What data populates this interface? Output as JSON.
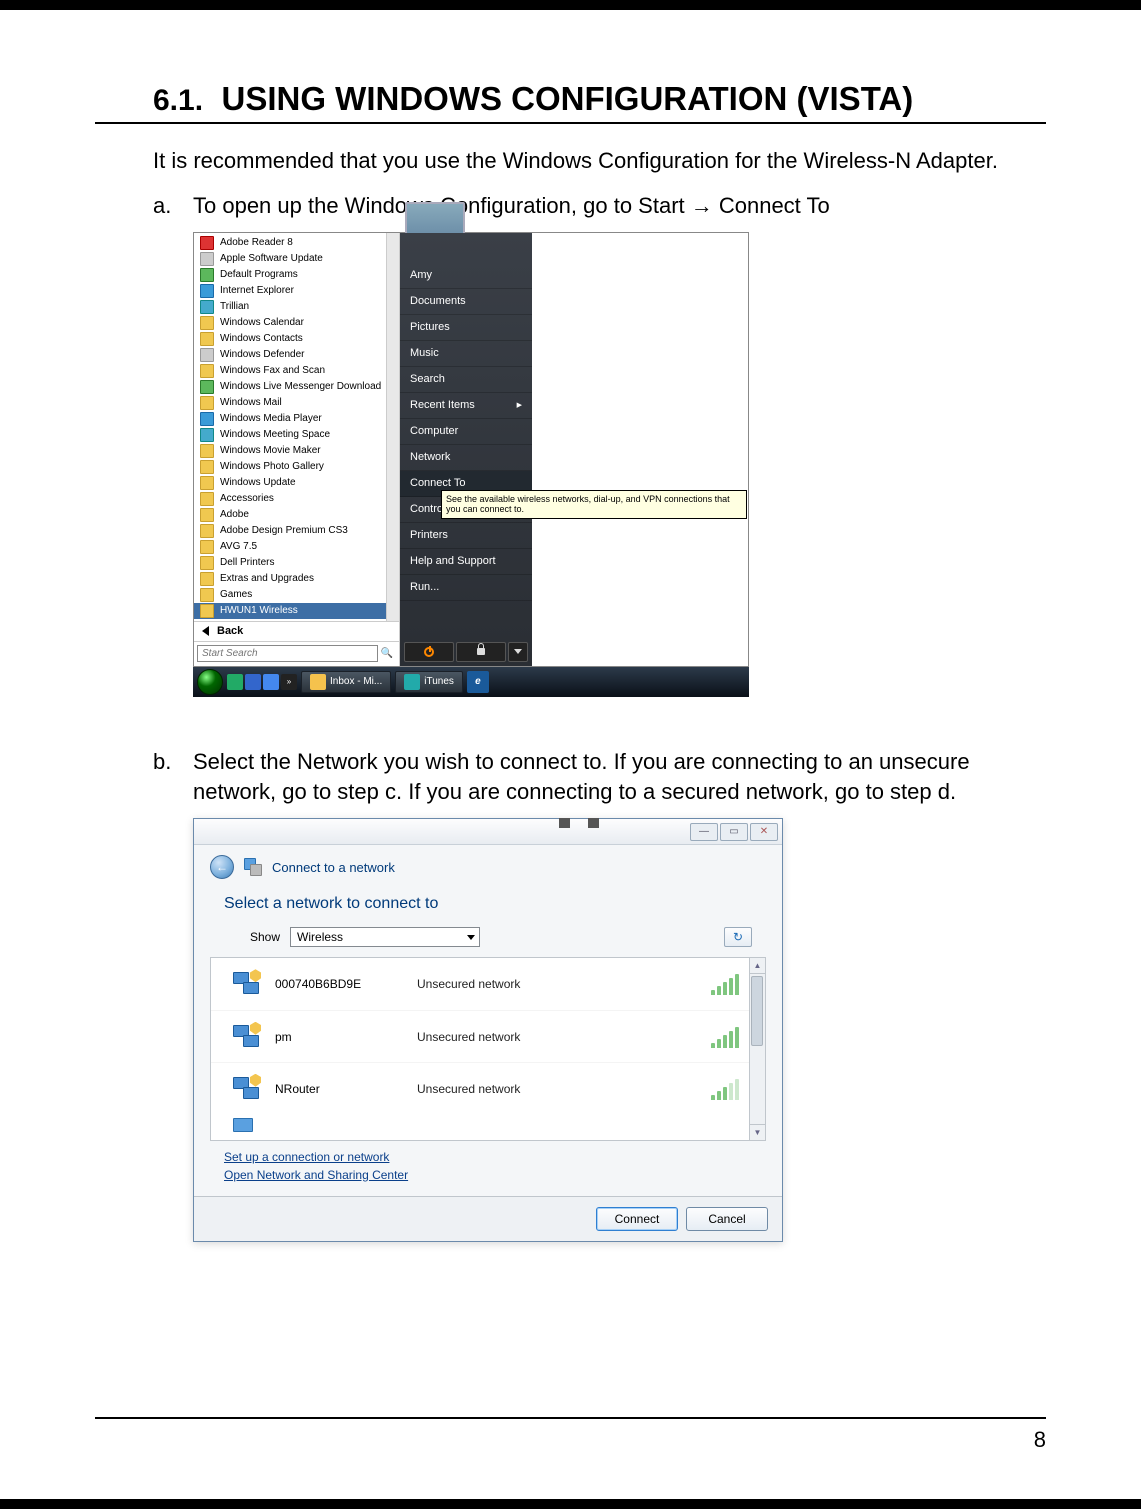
{
  "page_number": "8",
  "heading": {
    "num": "6.1.",
    "title": "USING WINDOWS CONFIGURATION (VISTA)"
  },
  "intro": "It is recommended that you use the Windows Configuration for the Wireless-N Adapter.",
  "step_a": {
    "marker": "a.",
    "text": "To open up the Windows Configuration, go to Start → Connect To"
  },
  "step_b": {
    "marker": "b.",
    "text": "Select the Network you wish to connect to. If you are connecting to an unsecure network, go to step c.  If you are connecting to a secured network, go to step d."
  },
  "start_menu": {
    "programs": [
      "Adobe Reader 8",
      "Apple Software Update",
      "Default Programs",
      "Internet Explorer",
      "Trillian",
      "Windows Calendar",
      "Windows Contacts",
      "Windows Defender",
      "Windows Fax and Scan",
      "Windows Live Messenger Download",
      "Windows Mail",
      "Windows Media Player",
      "Windows Meeting Space",
      "Windows Movie Maker",
      "Windows Photo Gallery",
      "Windows Update",
      "Accessories",
      "Adobe",
      "Adobe Design Premium CS3",
      "AVG 7.5",
      "Dell Printers",
      "Extras and Upgrades",
      "Games",
      "HWUN1 Wireless"
    ],
    "back": "Back",
    "search_placeholder": "Start Search",
    "user": "Amy",
    "right_items": [
      "Documents",
      "Pictures",
      "Music",
      "Search",
      "Recent Items",
      "Computer",
      "Network",
      "Connect To",
      "Control Panel",
      "Printers",
      "Help and Support",
      "Run..."
    ],
    "tooltip": "See the available wireless networks, dial-up, and VPN connections that you can connect to.",
    "taskbar": {
      "inbox": "Inbox - Mi...",
      "itunes": "iTunes"
    }
  },
  "connect_dialog": {
    "header": "Connect to a network",
    "subtitle": "Select a network to connect to",
    "show_label": "Show",
    "show_value": "Wireless",
    "networks": [
      {
        "name": "000740B6BD9E",
        "security": "Unsecured network"
      },
      {
        "name": "pm",
        "security": "Unsecured network"
      },
      {
        "name": "NRouter",
        "security": "Unsecured network"
      }
    ],
    "link_setup": "Set up a connection or network",
    "link_center": "Open Network and Sharing Center",
    "btn_connect": "Connect",
    "btn_cancel": "Cancel"
  }
}
